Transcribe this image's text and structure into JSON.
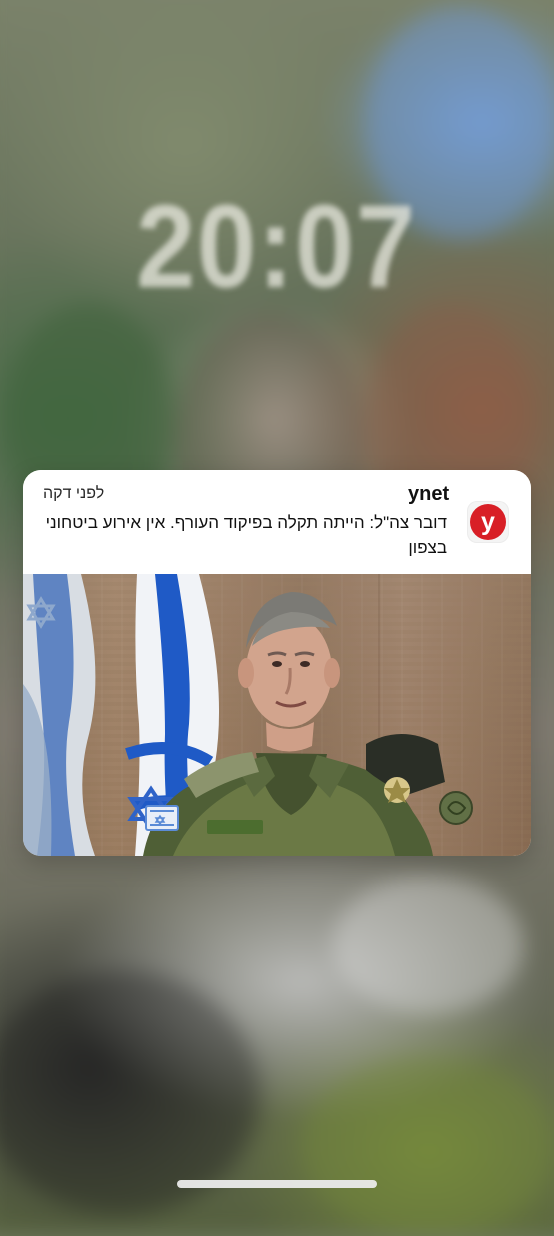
{
  "lock_screen": {
    "time": "20:07"
  },
  "notification": {
    "app_name": "ynet",
    "timestamp": "לפני דקה",
    "message": "דובר צה\"ל: הייתה תקלה בפיקוד העורף. אין אירוע ביטחוני בצפון",
    "icon_letter": "y"
  },
  "icons": {
    "app_icon": "ynet-app-icon"
  },
  "colors": {
    "brand_red": "#d81f26",
    "notification_bg": "#ffffff"
  }
}
